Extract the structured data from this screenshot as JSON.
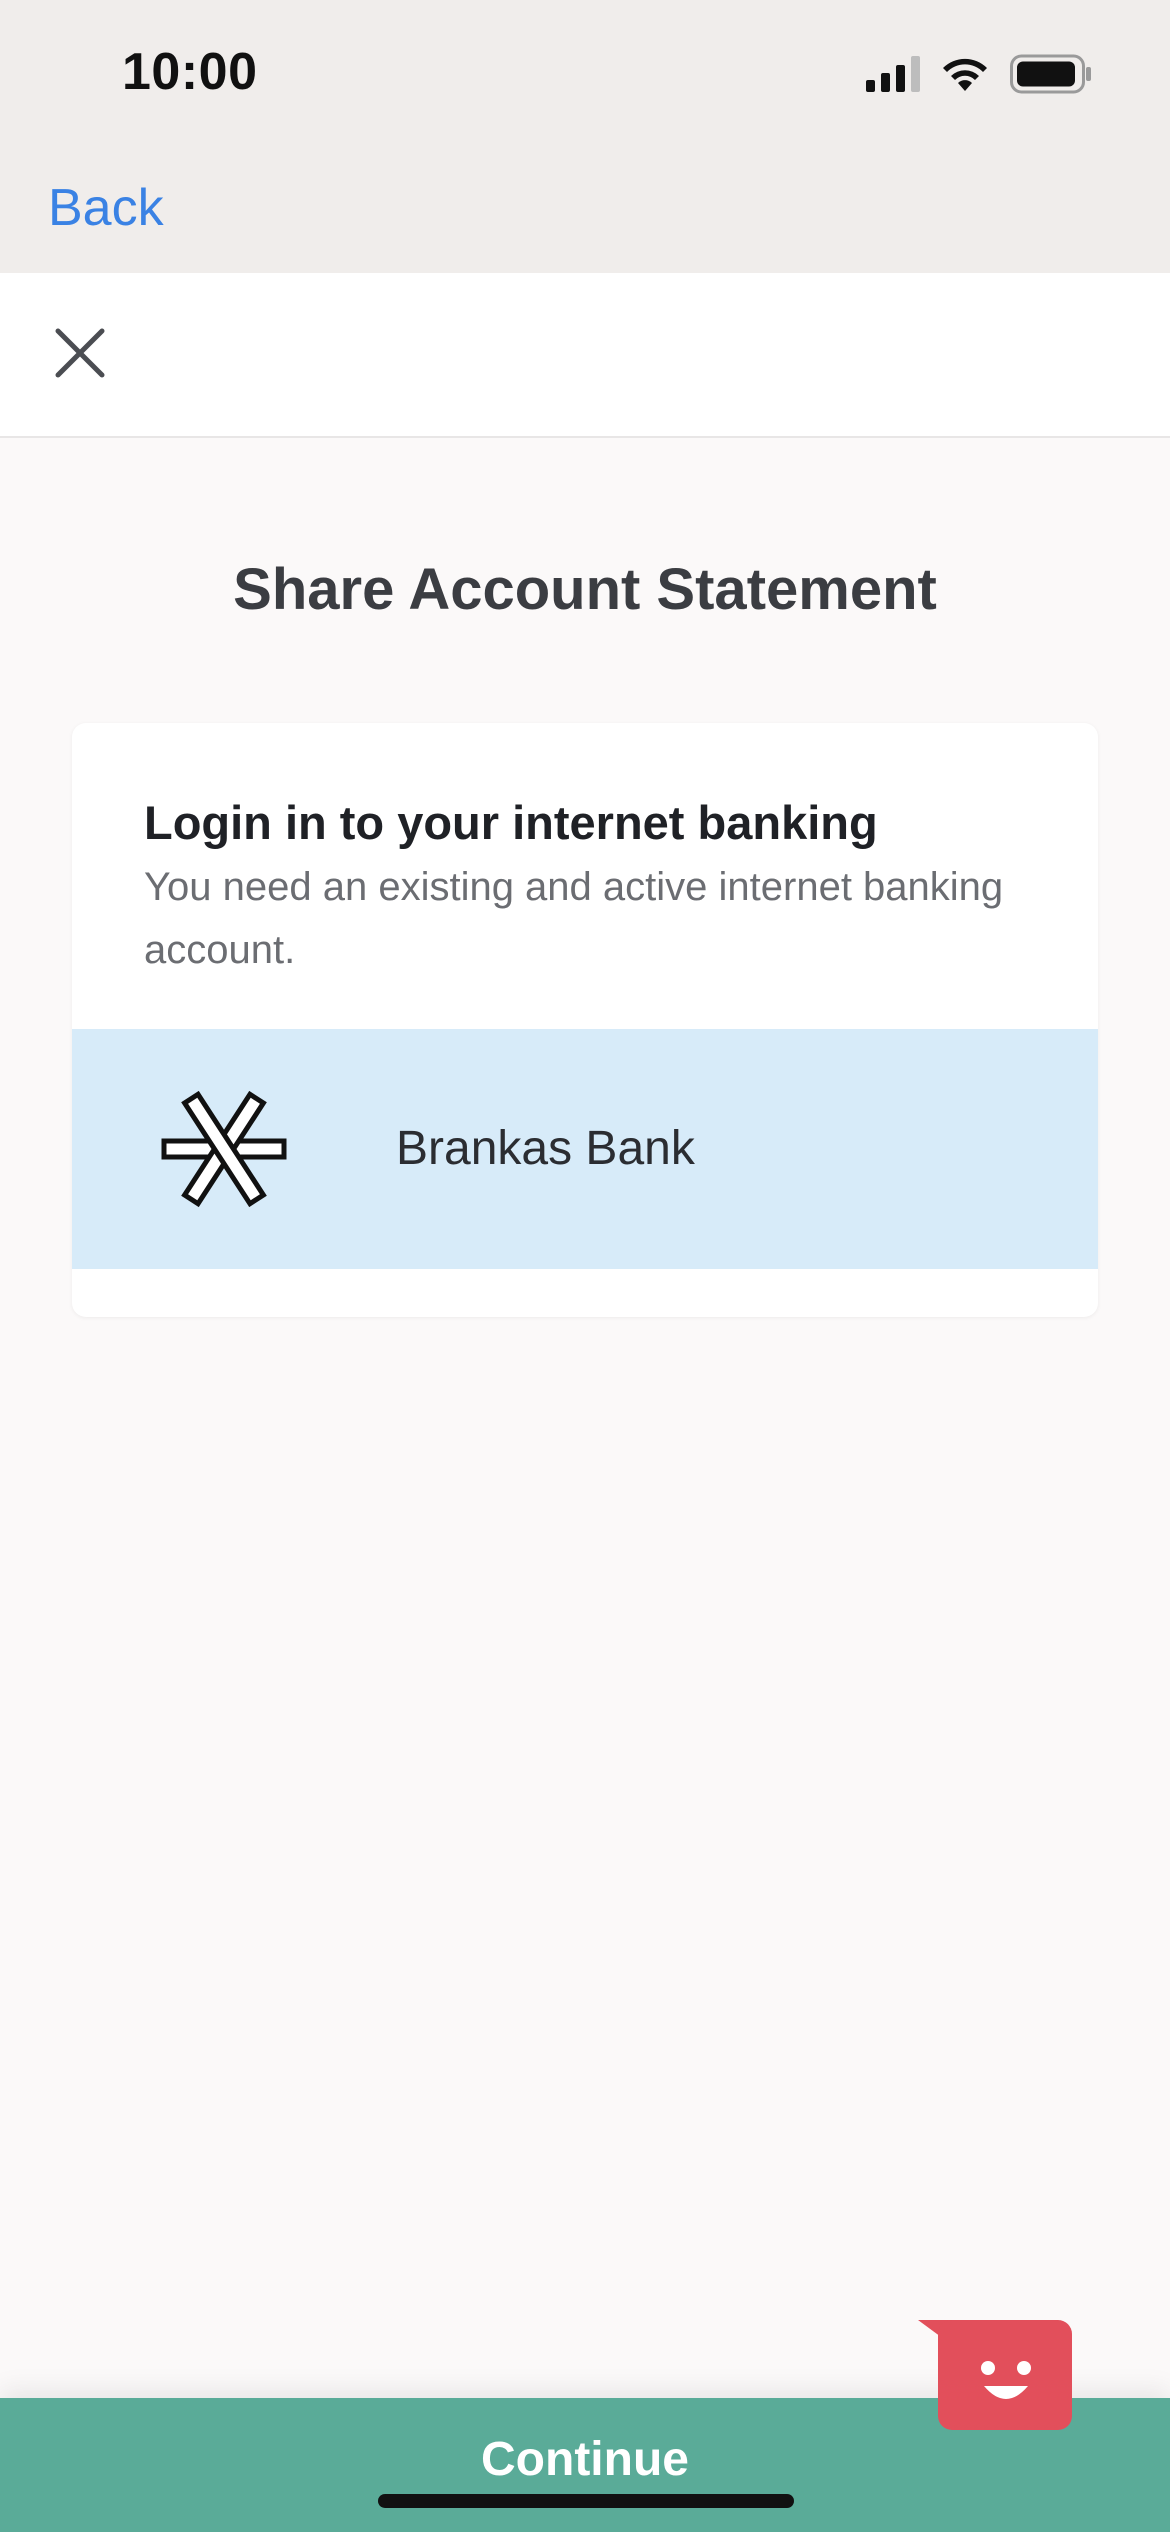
{
  "status_bar": {
    "time": "10:00"
  },
  "nav": {
    "back_label": "Back"
  },
  "main": {
    "title": "Share Account Statement",
    "card": {
      "heading": "Login in to your internet banking",
      "subtitle": "You need an existing and active internet banking account.",
      "bank": {
        "name": "Brankas Bank",
        "icon": "brankas-logo-icon"
      }
    }
  },
  "footer": {
    "continue_label": "Continue"
  },
  "colors": {
    "link": "#3a82e4",
    "bank_row_bg": "#d7ebf9",
    "continue_bg": "#5aab98",
    "chat_bg": "#e24f5b",
    "status_bg": "#f0edeb"
  }
}
